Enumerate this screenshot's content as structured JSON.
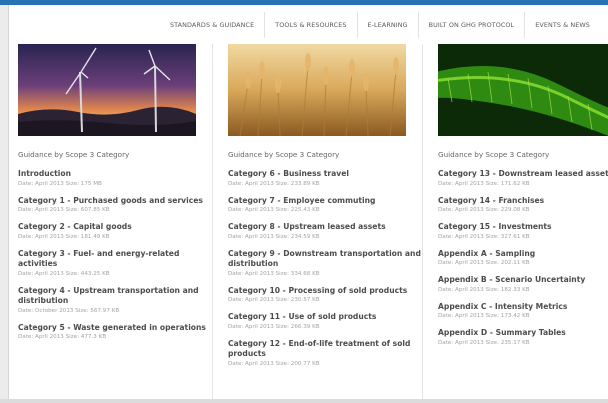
{
  "nav": {
    "items": [
      "STANDARDS & GUIDANCE",
      "TOOLS & RESOURCES",
      "E-LEARNING",
      "BUILT ON GHG PROTOCOL",
      "EVENTS & NEWS"
    ]
  },
  "columns": [
    {
      "heading": "Guidance by Scope 3 Category",
      "image": "wind-turbines-sunset-photo",
      "items": [
        {
          "title": "Introduction",
          "meta": "Date: April 2013  Size: 175 MB"
        },
        {
          "title": "Category 1 - Purchased goods and services",
          "meta": "Date: April 2013  Size: 607.85 KB"
        },
        {
          "title": "Category 2 - Capital goods",
          "meta": "Date: April 2013  Size: 181.49 KB"
        },
        {
          "title": "Category 3 - Fuel- and energy-related activities",
          "meta": "Date: April 2013  Size: 443.25 KB"
        },
        {
          "title": "Category 4 - Upstream transportation and distribution",
          "meta": "Date: October 2013  Size: 567.97 KB"
        },
        {
          "title": "Category 5 - Waste generated in operations",
          "meta": "Date: April 2013  Size: 477.3 KB"
        }
      ]
    },
    {
      "heading": "Guidance by Scope 3 Category",
      "image": "wheat-field-photo",
      "items": [
        {
          "title": "Category 6 - Business travel",
          "meta": "Date: April 2013  Size: 233.89 KB"
        },
        {
          "title": "Category 7 - Employee commuting",
          "meta": "Date: April 2013  Size: 225.43 KB"
        },
        {
          "title": "Category 8 - Upstream leased assets",
          "meta": "Date: April 2013  Size: 234.59 KB"
        },
        {
          "title": "Category 9 - Downstream transportation and distribution",
          "meta": "Date: April 2013  Size: 334.68 KB"
        },
        {
          "title": "Category 10 - Processing of sold products",
          "meta": "Date: April 2013  Size: 230.57 KB"
        },
        {
          "title": "Category 11 - Use of sold products",
          "meta": "Date: April 2013  Size: 266.39 KB"
        },
        {
          "title": "Category 12 - End-of-life treatment of sold products",
          "meta": "Date: April 2013  Size: 200.77 KB"
        }
      ]
    },
    {
      "heading": "Guidance by Scope 3 Category",
      "image": "green-leaf-photo",
      "items": [
        {
          "title": "Category 13 - Downstream leased assets",
          "meta": "Date: April 2013  Size: 171.62 KB"
        },
        {
          "title": "Category 14 - Franchises",
          "meta": "Date: April 2013  Size: 229.08 KB"
        },
        {
          "title": "Category 15 - Investments",
          "meta": "Date: April 2013  Size: 327.61 KB"
        },
        {
          "title": "Appendix A - Sampling",
          "meta": "Date: April 2013  Size: 202.11 KB"
        },
        {
          "title": "Appendix B - Scenario Uncertainty",
          "meta": "Date: April 2013  Size: 182.33 KB"
        },
        {
          "title": "Appendix C - Intensity Metrics",
          "meta": "Date: April 2013  Size: 173.42 KB"
        },
        {
          "title": "Appendix D - Summary Tables",
          "meta": "Date: April 2013  Size: 235.17 KB"
        }
      ]
    }
  ]
}
